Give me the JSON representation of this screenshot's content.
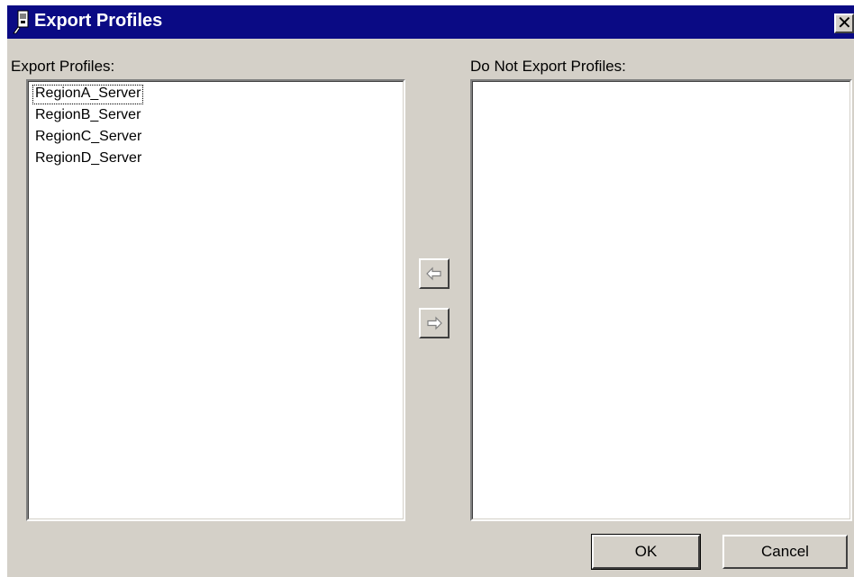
{
  "window": {
    "title": "Export Profiles",
    "title_bar_color": "#0a0a84",
    "close_label": "✕"
  },
  "export_list": {
    "label": "Export Profiles:",
    "items": [
      "RegionA_Server",
      "RegionB_Server",
      "RegionC_Server",
      "RegionD_Server"
    ],
    "focused_item": "RegionA_Server"
  },
  "do_not_export_list": {
    "label": "Do Not Export Profiles:",
    "items": []
  },
  "move_buttons": {
    "move_left_icon": "arrow-left-icon",
    "move_right_icon": "arrow-right-icon"
  },
  "footer": {
    "ok_label": "OK",
    "cancel_label": "Cancel"
  }
}
